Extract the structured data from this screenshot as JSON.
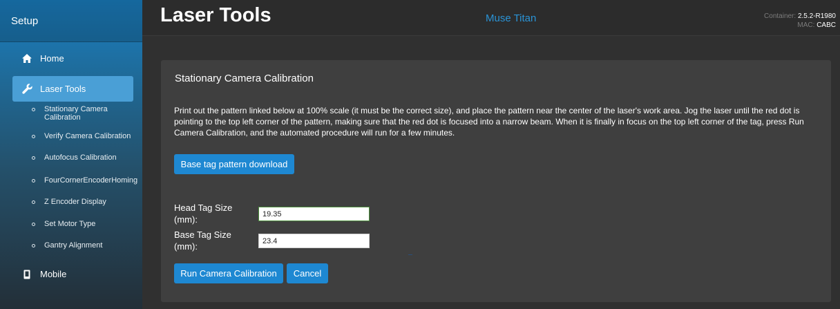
{
  "sidebar": {
    "header": "Setup",
    "items": [
      {
        "label": "Home",
        "icon": "home-icon"
      },
      {
        "label": "Laser Tools",
        "icon": "wrench-icon"
      },
      {
        "label": "Mobile",
        "icon": "mobile-icon"
      }
    ],
    "sub_items": [
      "Stationary Camera Calibration",
      "Verify Camera Calibration",
      "Autofocus Calibration",
      "FourCornerEncoderHoming",
      "Z Encoder Display",
      "Set Motor Type",
      "Gantry Alignment"
    ]
  },
  "header": {
    "title": "Laser Tools",
    "device": "Muse Titan",
    "container_label": "Container:",
    "container_value": "2.5.2-R1980",
    "mac_label": "MAC:",
    "mac_value": "CABC"
  },
  "card": {
    "title": "Stationary Camera Calibration",
    "description": "Print out the pattern linked below at 100% scale (it must be the correct size), and place the pattern near the center of the laser's work area. Jog the laser until the red dot is pointing to the top left corner of the pattern, making sure that the red dot is focused into a narrow beam. When it is finally in focus on the top left corner of the tag, press Run Camera Calibration, and the automated procedure will run for a few minutes.",
    "download_button": "Base tag pattern download",
    "head_tag_label": "Head Tag Size (mm):",
    "head_tag_value": "19.35",
    "base_tag_label": "Base Tag Size (mm):",
    "base_tag_value": "23.4",
    "run_button": "Run Camera Calibration",
    "cancel_button": "Cancel"
  },
  "colors": {
    "accent": "#1e88d2",
    "active_nav": "#4a9fd6",
    "device_text": "#2a93d6",
    "background": "#303030",
    "card": "#3f3f3f"
  }
}
